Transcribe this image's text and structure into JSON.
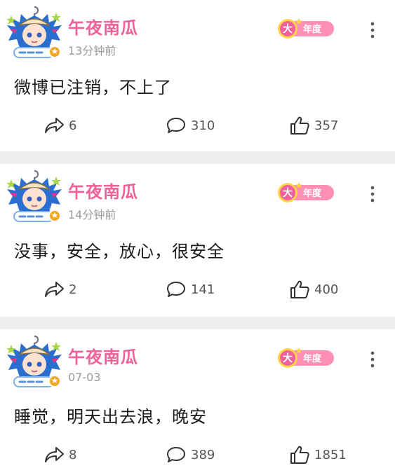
{
  "colors": {
    "username": "#f0609a",
    "badge": "#ff8fb4",
    "badge_circle": "#f0609a",
    "background": "#ffffff",
    "separator": "#efeff1"
  },
  "icons": {
    "repost": "repost-arrow-icon",
    "comment": "comment-bubble-icon",
    "like": "thumbs-up-icon",
    "more": "vertical-dots-icon"
  },
  "posts": [
    {
      "username": "午夜南瓜",
      "timestamp": "13分钟前",
      "badge_big": "大",
      "badge_label": "年度",
      "content": "微博已注销，不上了",
      "reposts": "6",
      "comments": "310",
      "likes": "357"
    },
    {
      "username": "午夜南瓜",
      "timestamp": "14分钟前",
      "badge_big": "大",
      "badge_label": "年度",
      "content": "没事，安全，放心，很安全",
      "reposts": "2",
      "comments": "141",
      "likes": "400"
    },
    {
      "username": "午夜南瓜",
      "timestamp": "07-03",
      "badge_big": "大",
      "badge_label": "年度",
      "content": "睡觉，明天出去浪，晚安",
      "reposts": "8",
      "comments": "389",
      "likes": "1851"
    }
  ]
}
